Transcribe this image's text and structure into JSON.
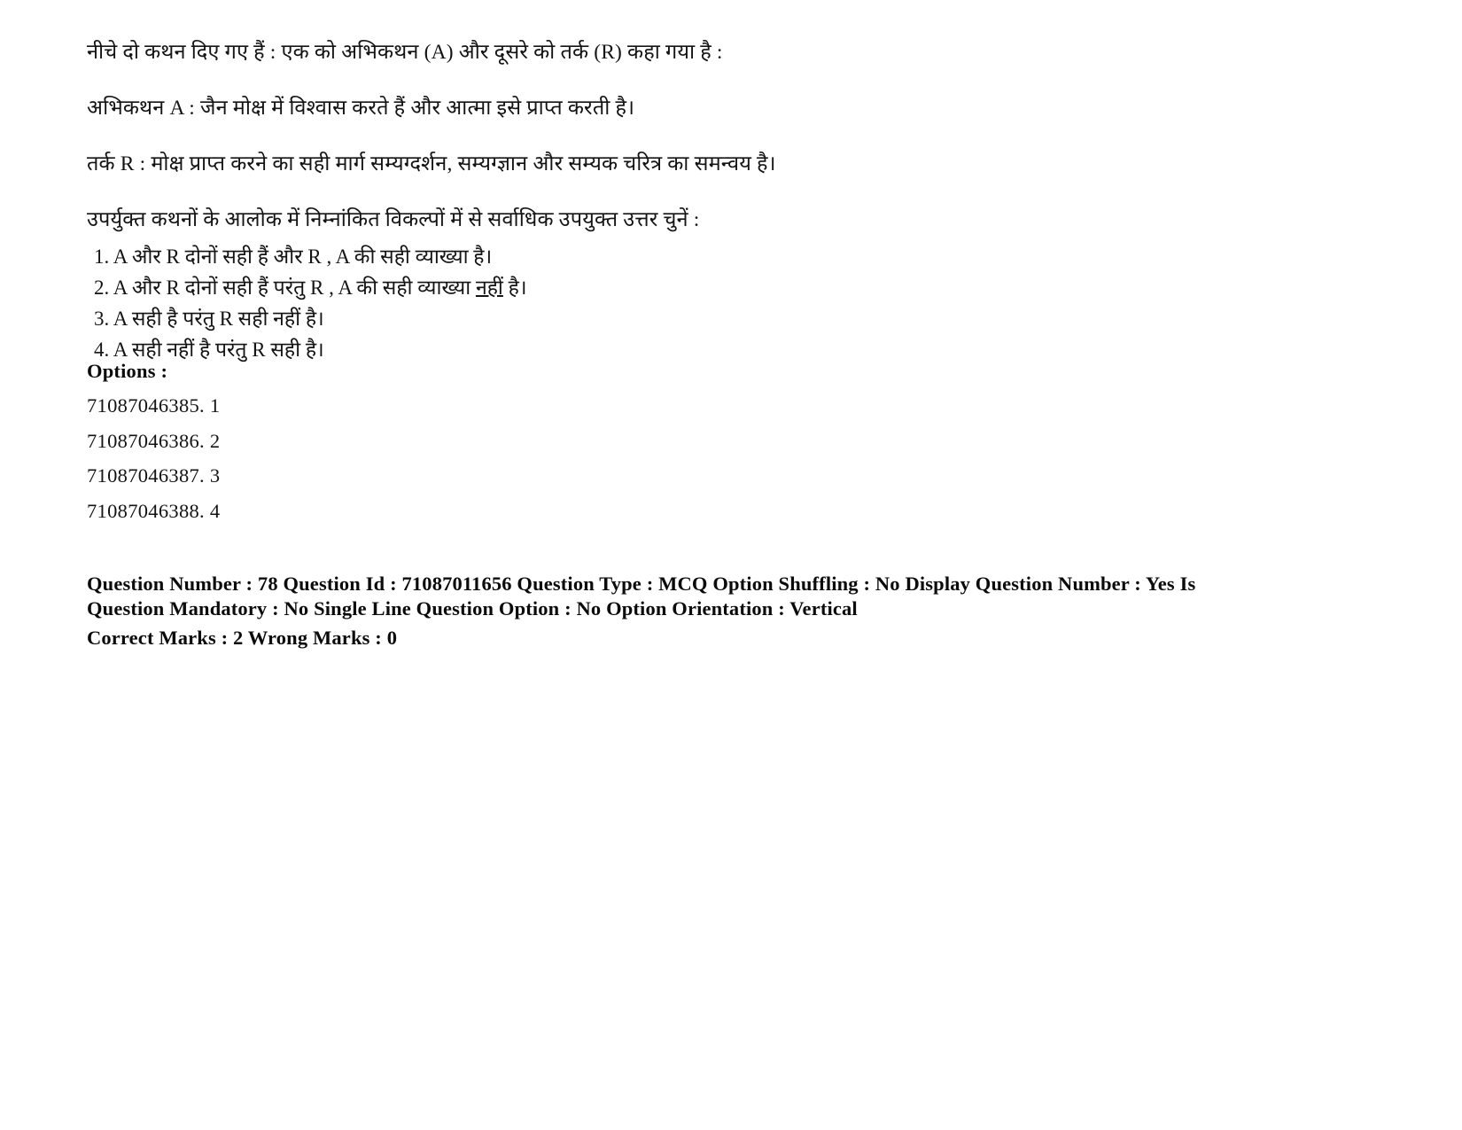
{
  "document": {
    "type": "exam-question-paper",
    "language": "Hindi",
    "background_color": "#ffffff",
    "text_color": "#141414"
  },
  "question": {
    "stem_lines": [
      "नीचे दो कथन दिए गए हैं  : एक को अभिकथन (A) और दूसरे को तर्क (R) कहा गया है :",
      "अभिकथन A : जैन मोक्ष में विश्वास करते हैं और आत्मा इसे प्राप्त करती है।",
      "तर्क R : मोक्ष प्राप्त करने का सही मार्ग सम्यग्दर्शन, सम्यग्ज्ञान और सम्यक चरित्र का समन्वय है।",
      "उपर्युक्त कथनों के आलोक में निम्नांकित विकल्पों में से सर्वाधिक उपयुक्त उत्तर चुनें :"
    ],
    "choices": [
      {
        "number": "1.",
        "text_before": "A और R दोनों सही हैं और R , A की सही व्याख्या है।",
        "underlined": "",
        "text_after": ""
      },
      {
        "number": "2.",
        "text_before": "A और R दोनों सही हैं परंतु  R , A की सही व्याख्या ",
        "underlined": "नहीं",
        "text_after": " है।"
      },
      {
        "number": "3.",
        "text_before": "A सही है परंतु  R  सही नहीं  है।",
        "underlined": "",
        "text_after": ""
      },
      {
        "number": "4.",
        "text_before": "A सही नहीं  है परंतु R सही है।",
        "underlined": "",
        "text_after": ""
      }
    ]
  },
  "options": {
    "heading": "Options :",
    "entries": [
      "71087046385. 1",
      "71087046386. 2",
      "71087046387. 3",
      "71087046388. 4"
    ]
  },
  "metadata": {
    "line1": "Question Number : 78 Question Id : 71087011656 Question Type : MCQ Option Shuffling : No Display Question Number : Yes Is",
    "line2": "Question Mandatory : No Single Line Question Option : No Option Orientation : Vertical",
    "line3": "Correct Marks : 2 Wrong Marks : 0",
    "fields": {
      "question_number": "78",
      "question_id": "71087011656",
      "question_type": "MCQ",
      "option_shuffling": "No",
      "display_question_number": "Yes",
      "is_question_mandatory": "No",
      "single_line_question_option": "No",
      "option_orientation": "Vertical",
      "correct_marks": "2",
      "wrong_marks": "0"
    }
  }
}
